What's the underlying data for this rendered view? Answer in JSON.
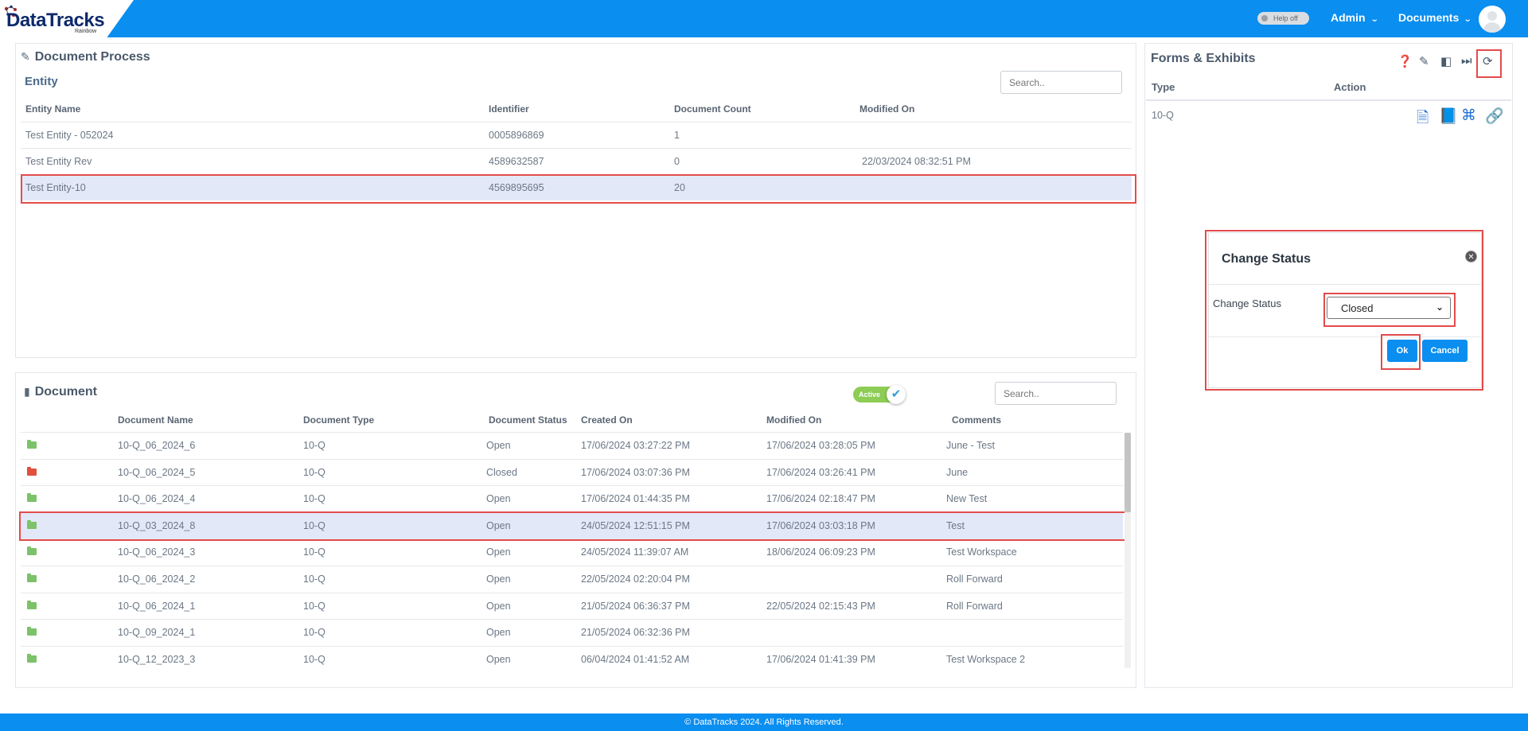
{
  "header": {
    "logo_text": "DataTracks",
    "logo_sub": "Rainbow",
    "help_toggle": "Help off",
    "nav": [
      {
        "label": "Admin"
      },
      {
        "label": "Documents"
      }
    ]
  },
  "document_process": {
    "title": "Document Process",
    "entity": {
      "subtitle": "Entity",
      "search_placeholder": "Search..",
      "columns": [
        "Entity Name",
        "Identifier",
        "Document Count",
        "Modified On"
      ],
      "rows": [
        [
          "Test Entity - 052024",
          "0005896869",
          "1",
          ""
        ],
        [
          "Test Entity Rev",
          "4589632587",
          "0",
          "22/03/2024 08:32:51 PM"
        ],
        [
          "Test Entity-10",
          "4569895695",
          "20",
          ""
        ]
      ]
    }
  },
  "document": {
    "title": "Document",
    "toggle_label": "Active",
    "search_placeholder": "Search..",
    "columns": [
      "Document Name",
      "Document Type",
      "Document Status",
      "Created On",
      "Modified On",
      "Comments"
    ],
    "rows": [
      {
        "name": "10-Q_06_2024_6",
        "type": "10-Q",
        "status": "Open",
        "created": "17/06/2024 03:27:22 PM",
        "modified": "17/06/2024 03:28:05 PM",
        "comments": "June - Test",
        "color": "#7cc26a"
      },
      {
        "name": "10-Q_06_2024_5",
        "type": "10-Q",
        "status": "Closed",
        "created": "17/06/2024 03:07:36 PM",
        "modified": "17/06/2024 03:26:41 PM",
        "comments": "June",
        "color": "#e0503d"
      },
      {
        "name": "10-Q_06_2024_4",
        "type": "10-Q",
        "status": "Open",
        "created": "17/06/2024 01:44:35 PM",
        "modified": "17/06/2024 02:18:47 PM",
        "comments": "New Test",
        "color": "#7cc26a"
      },
      {
        "name": "10-Q_03_2024_8",
        "type": "10-Q",
        "status": "Open",
        "created": "24/05/2024 12:51:15 PM",
        "modified": "17/06/2024 03:03:18 PM",
        "comments": "Test",
        "color": "#7cc26a"
      },
      {
        "name": "10-Q_06_2024_3",
        "type": "10-Q",
        "status": "Open",
        "created": "24/05/2024 11:39:07 AM",
        "modified": "18/06/2024 06:09:23 PM",
        "comments": "Test Workspace",
        "color": "#7cc26a"
      },
      {
        "name": "10-Q_06_2024_2",
        "type": "10-Q",
        "status": "Open",
        "created": "22/05/2024 02:20:04 PM",
        "modified": "",
        "comments": "Roll Forward",
        "color": "#7cc26a"
      },
      {
        "name": "10-Q_06_2024_1",
        "type": "10-Q",
        "status": "Open",
        "created": "21/05/2024 06:36:37 PM",
        "modified": "22/05/2024 02:15:43 PM",
        "comments": "Roll Forward",
        "color": "#7cc26a"
      },
      {
        "name": "10-Q_09_2024_1",
        "type": "10-Q",
        "status": "Open",
        "created": "21/05/2024 06:32:36 PM",
        "modified": "",
        "comments": "",
        "color": "#7cc26a"
      },
      {
        "name": "10-Q_12_2023_3",
        "type": "10-Q",
        "status": "Open",
        "created": "06/04/2024 01:41:52 AM",
        "modified": "17/06/2024 01:41:39 PM",
        "comments": "Test Workspace 2",
        "color": "#7cc26a"
      }
    ]
  },
  "forms": {
    "title": "Forms & Exhibits",
    "columns": [
      "Type",
      "Action"
    ],
    "rows": [
      {
        "type": "10-Q"
      }
    ]
  },
  "modal": {
    "title": "Change Status",
    "label": "Change Status",
    "selected": "Closed",
    "ok": "Ok",
    "cancel": "Cancel"
  },
  "footer": {
    "text": "© DataTracks 2024. All Rights Reserved."
  }
}
